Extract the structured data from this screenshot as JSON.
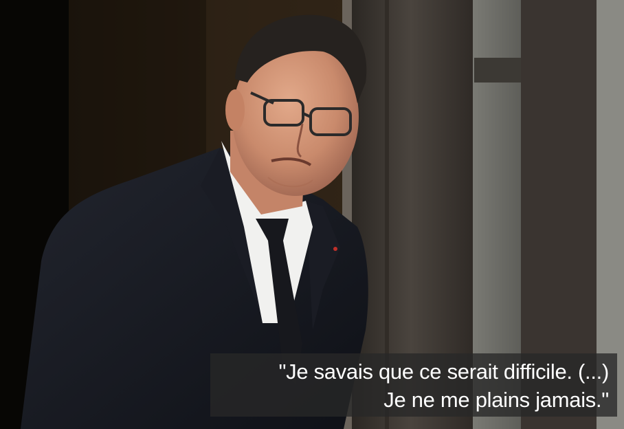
{
  "photo": {
    "subject": "man-in-dark-suit-with-glasses",
    "background_colors": {
      "doorway": "#1a130c",
      "frame": "#3d3731",
      "pane": "#6e6e69"
    }
  },
  "caption": {
    "line1": "\"Je savais que ce serait difficile. (...)",
    "line2": "Je ne me plains jamais.\""
  }
}
